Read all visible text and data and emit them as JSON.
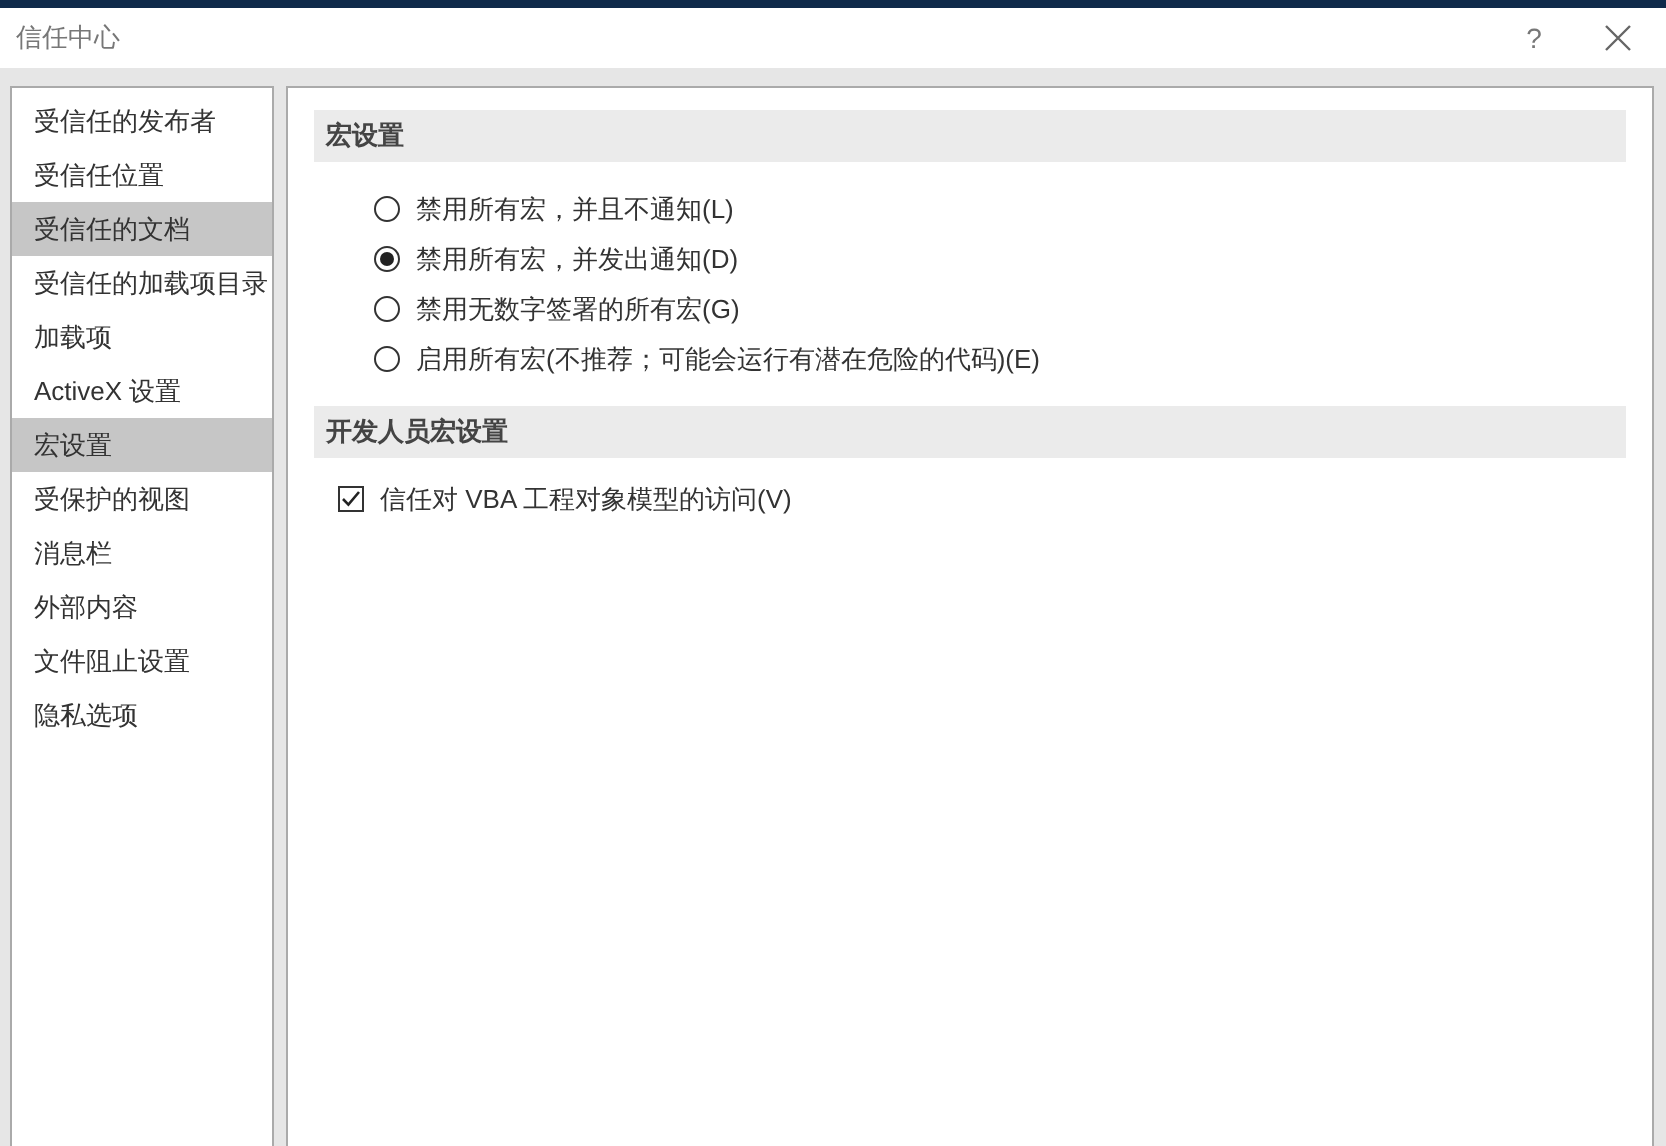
{
  "window": {
    "title": "信任中心",
    "help": "?"
  },
  "sidebar": {
    "items": [
      {
        "label": "受信任的发布者",
        "selected": false
      },
      {
        "label": "受信任位置",
        "selected": false
      },
      {
        "label": "受信任的文档",
        "selected": true
      },
      {
        "label": "受信任的加载项目录",
        "selected": false
      },
      {
        "label": "加载项",
        "selected": false
      },
      {
        "label": "ActiveX 设置",
        "selected": false
      },
      {
        "label": "宏设置",
        "selected": true
      },
      {
        "label": "受保护的视图",
        "selected": false
      },
      {
        "label": "消息栏",
        "selected": false
      },
      {
        "label": "外部内容",
        "selected": false
      },
      {
        "label": "文件阻止设置",
        "selected": false
      },
      {
        "label": "隐私选项",
        "selected": false
      }
    ]
  },
  "sections": [
    {
      "title": "宏设置",
      "options": [
        {
          "kind": "radio",
          "label": "禁用所有宏，并且不通知(L)",
          "selected": false
        },
        {
          "kind": "radio",
          "label": "禁用所有宏，并发出通知(D)",
          "selected": true
        },
        {
          "kind": "radio",
          "label": "禁用无数字签署的所有宏(G)",
          "selected": false
        },
        {
          "kind": "radio",
          "label": "启用所有宏(不推荐；可能会运行有潜在危险的代码)(E)",
          "selected": false
        }
      ]
    },
    {
      "title": "开发人员宏设置",
      "options": [
        {
          "kind": "checkbox",
          "label": "信任对 VBA 工程对象模型的访问(V)",
          "checked": true
        }
      ]
    }
  ]
}
